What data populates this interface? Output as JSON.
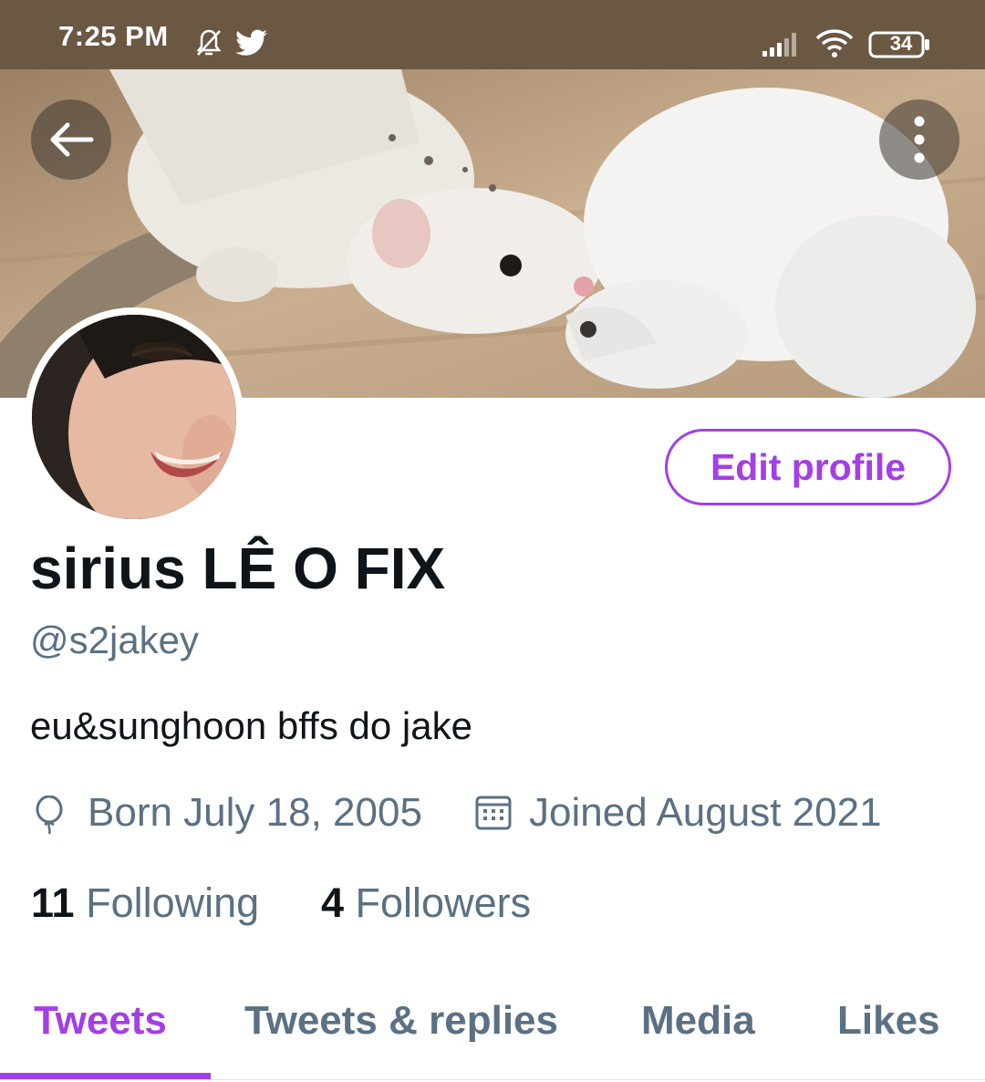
{
  "status_bar": {
    "time": "7:25 PM",
    "battery": "34",
    "icons": [
      "muted-bell-icon",
      "twitter-bird-icon",
      "signal-icon",
      "wifi-icon",
      "battery-icon"
    ]
  },
  "header": {
    "back_icon": "arrow-left-icon",
    "more_icon": "vertical-dots-icon"
  },
  "profile": {
    "edit_button": "Edit profile",
    "display_name": "sirius LÊ O FIX",
    "handle": "@s2jakey",
    "bio": "eu&sunghoon bffs do jake",
    "born": "Born July 18, 2005",
    "joined": "Joined August 2021",
    "following_count": "11",
    "following_label": "Following",
    "followers_count": "4",
    "followers_label": "Followers"
  },
  "tabs": [
    {
      "label": "Tweets",
      "active": true
    },
    {
      "label": "Tweets & replies",
      "active": false
    },
    {
      "label": "Media",
      "active": false
    },
    {
      "label": "Likes",
      "active": false
    }
  ],
  "colors": {
    "accent": "#a43ee6",
    "status_bar": "#6b5842",
    "text_primary": "#0f1419",
    "text_secondary": "#5b7083"
  }
}
